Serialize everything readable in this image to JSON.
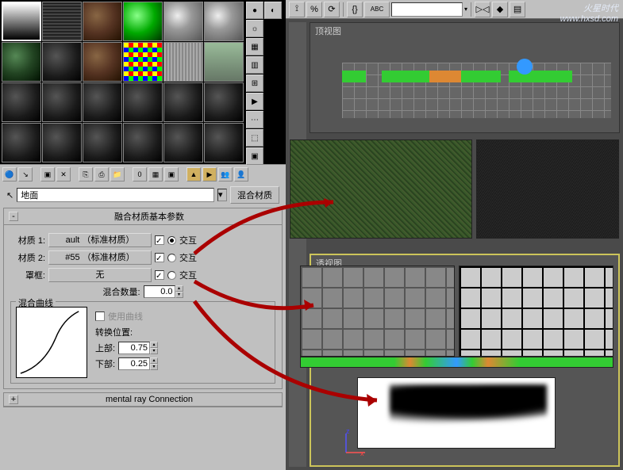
{
  "material_name": "地面",
  "material_type_btn": "混合材质",
  "rollout_blend": {
    "title": "融合材质基本参数",
    "mat1_label": "材质 1:",
    "mat1_value": "ault （标准材质）",
    "mat2_label": "材质 2:",
    "mat2_value": "#55 （标准材质）",
    "mask_label": "罩框:",
    "mask_value": "无",
    "interactive": "交互",
    "mix_amount_label": "混合数量:",
    "mix_amount_value": "0.0"
  },
  "curve_group": {
    "title": "混合曲线",
    "use_curve": "使用曲线",
    "transition_label": "转换位置:",
    "upper_label": "上部:",
    "upper_value": "0.75",
    "lower_label": "下部:",
    "lower_value": "0.25"
  },
  "rollout_mr": {
    "title": "mental ray Connection",
    "collapsed": true
  },
  "viewport_top_label": "顶视图",
  "viewport_persp_label": "透视图",
  "top_toolbar": {
    "percent": "%",
    "abc": "ABC"
  },
  "watermark_line1": "火星时代",
  "watermark_line2": "www.hxsd.com",
  "gizmo": {
    "z": "z",
    "x": "x"
  },
  "pick_icon": "↖"
}
